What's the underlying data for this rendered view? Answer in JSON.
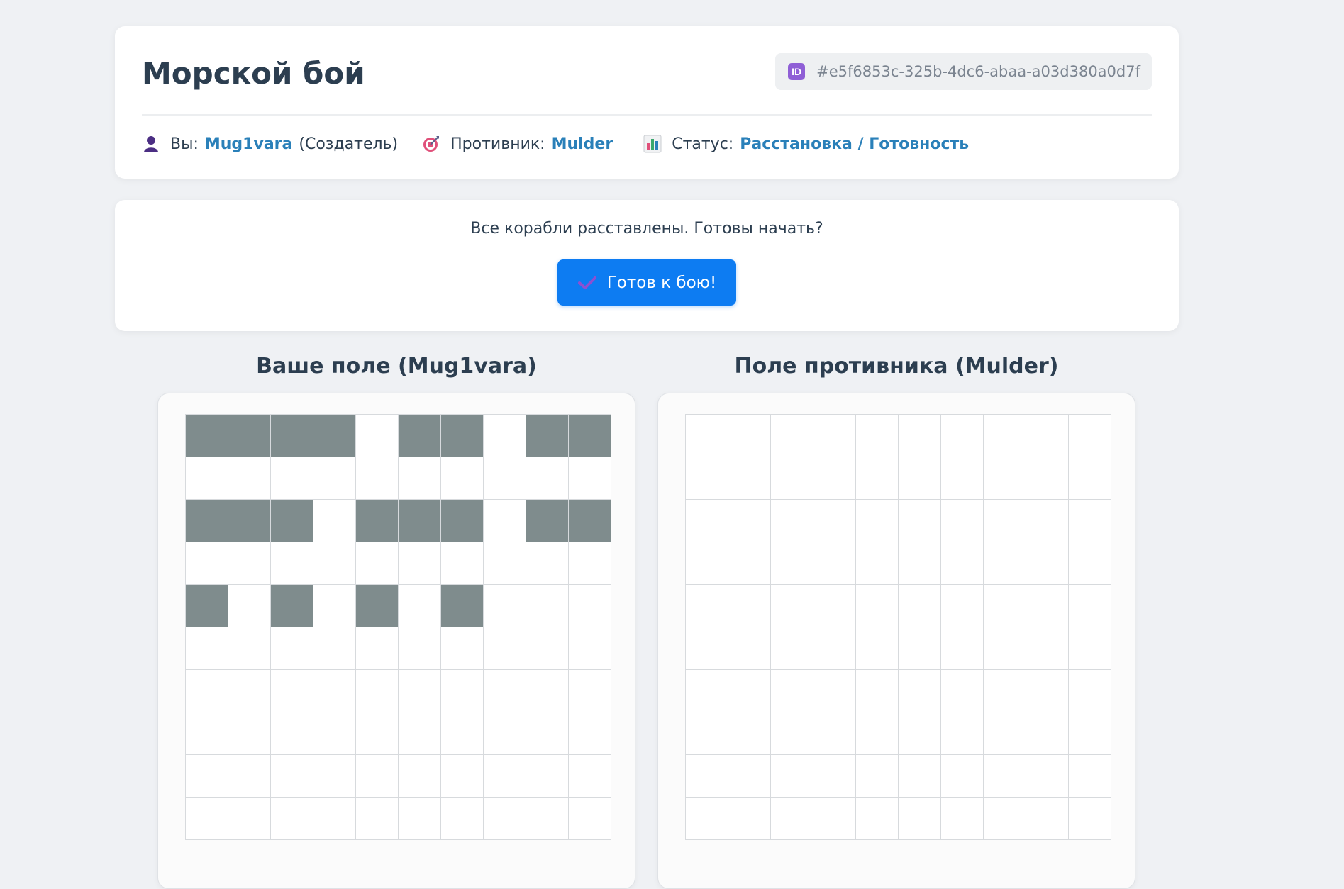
{
  "header": {
    "title": "Морской бой",
    "game_id": "#e5f6853c-325b-4dc6-abaa-a03d380a0d7f",
    "game_id_icon": "ID",
    "you_label": "Вы:",
    "you_name": "Mug1vara",
    "you_role": "(Создатель)",
    "opponent_label": "Противник:",
    "opponent_name": "Mulder",
    "status_label": "Статус:",
    "status_value": "Расстановка / Готовность"
  },
  "action": {
    "message": "Все корабли расставлены. Готовы начать?",
    "ready_button": "Готов к бою!"
  },
  "boards": {
    "own_title": "Ваше поле (Mug1vara)",
    "enemy_title": "Поле противника (Mulder)",
    "own_grid": [
      [
        1,
        1,
        1,
        1,
        0,
        1,
        1,
        0,
        1,
        1
      ],
      [
        0,
        0,
        0,
        0,
        0,
        0,
        0,
        0,
        0,
        0
      ],
      [
        1,
        1,
        1,
        0,
        1,
        1,
        1,
        0,
        1,
        1
      ],
      [
        0,
        0,
        0,
        0,
        0,
        0,
        0,
        0,
        0,
        0
      ],
      [
        1,
        0,
        1,
        0,
        1,
        0,
        1,
        0,
        0,
        0
      ],
      [
        0,
        0,
        0,
        0,
        0,
        0,
        0,
        0,
        0,
        0
      ],
      [
        0,
        0,
        0,
        0,
        0,
        0,
        0,
        0,
        0,
        0
      ],
      [
        0,
        0,
        0,
        0,
        0,
        0,
        0,
        0,
        0,
        0
      ],
      [
        0,
        0,
        0,
        0,
        0,
        0,
        0,
        0,
        0,
        0
      ],
      [
        0,
        0,
        0,
        0,
        0,
        0,
        0,
        0,
        0,
        0
      ]
    ],
    "enemy_grid": [
      [
        0,
        0,
        0,
        0,
        0,
        0,
        0,
        0,
        0,
        0
      ],
      [
        0,
        0,
        0,
        0,
        0,
        0,
        0,
        0,
        0,
        0
      ],
      [
        0,
        0,
        0,
        0,
        0,
        0,
        0,
        0,
        0,
        0
      ],
      [
        0,
        0,
        0,
        0,
        0,
        0,
        0,
        0,
        0,
        0
      ],
      [
        0,
        0,
        0,
        0,
        0,
        0,
        0,
        0,
        0,
        0
      ],
      [
        0,
        0,
        0,
        0,
        0,
        0,
        0,
        0,
        0,
        0
      ],
      [
        0,
        0,
        0,
        0,
        0,
        0,
        0,
        0,
        0,
        0
      ],
      [
        0,
        0,
        0,
        0,
        0,
        0,
        0,
        0,
        0,
        0
      ],
      [
        0,
        0,
        0,
        0,
        0,
        0,
        0,
        0,
        0,
        0
      ],
      [
        0,
        0,
        0,
        0,
        0,
        0,
        0,
        0,
        0,
        0
      ]
    ]
  },
  "colors": {
    "ship": "#7f8c8d",
    "accent": "#2a80b9",
    "button": "#0d7cf2"
  }
}
